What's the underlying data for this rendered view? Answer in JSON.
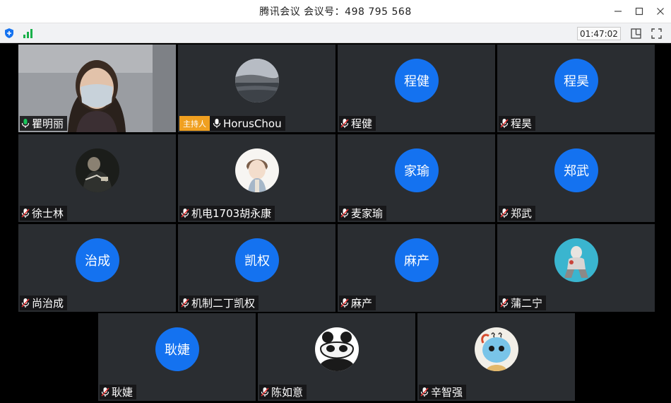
{
  "window": {
    "title": "腾讯会议 会议号：498 795 568"
  },
  "toolbar": {
    "timer": "01:47:02",
    "icons": [
      "shield-icon",
      "signal-icon",
      "layout-icon",
      "fullscreen-icon"
    ]
  },
  "host_badge": "主持人",
  "colors": {
    "avatar_blue": "#1472f0",
    "tile_bg": "#2a2d31",
    "host_badge": "#f0a020",
    "mic_on": "#19c45a",
    "mic_muted": "#e03030"
  },
  "participants": [
    {
      "name": "瞿明丽",
      "avatar": "",
      "mic": "on",
      "video": true,
      "host": false
    },
    {
      "name": "HorusChou",
      "avatar": "",
      "mic": "white",
      "video": false,
      "host": true
    },
    {
      "name": "程健",
      "avatar": "程健",
      "mic": "muted",
      "video": false,
      "host": false
    },
    {
      "name": "程昊",
      "avatar": "程昊",
      "mic": "muted",
      "video": false,
      "host": false
    },
    {
      "name": "徐士林",
      "avatar": "",
      "mic": "muted",
      "video": false,
      "host": false
    },
    {
      "name": "机电1703胡永康",
      "avatar": "",
      "mic": "muted",
      "video": false,
      "host": false
    },
    {
      "name": "麦家瑜",
      "avatar": "家瑜",
      "mic": "muted",
      "video": false,
      "host": false
    },
    {
      "name": "郑武",
      "avatar": "郑武",
      "mic": "muted",
      "video": false,
      "host": false
    },
    {
      "name": "尚治成",
      "avatar": "治成",
      "mic": "muted",
      "video": false,
      "host": false
    },
    {
      "name": "机制二丁凯权",
      "avatar": "凯权",
      "mic": "muted",
      "video": false,
      "host": false
    },
    {
      "name": "麻产",
      "avatar": "麻产",
      "mic": "muted",
      "video": false,
      "host": false
    },
    {
      "name": "蒲二宁",
      "avatar": "",
      "mic": "muted",
      "video": false,
      "host": false
    },
    {
      "name": "耿婕",
      "avatar": "耿婕",
      "mic": "muted",
      "video": false,
      "host": false
    },
    {
      "name": "陈如意",
      "avatar": "",
      "mic": "muted",
      "video": false,
      "host": false
    },
    {
      "name": "辛智强",
      "avatar": "",
      "mic": "muted",
      "video": false,
      "host": false
    }
  ]
}
